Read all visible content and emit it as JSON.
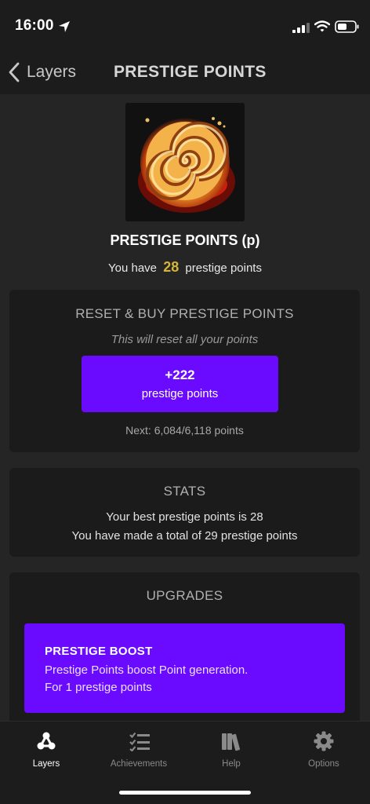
{
  "status_bar": {
    "time": "16:00",
    "icons": [
      "location-arrow-icon",
      "signal-icon",
      "wifi-icon",
      "battery-icon"
    ]
  },
  "nav": {
    "back_label": "Layers",
    "title": "PRESTIGE POINTS"
  },
  "layer": {
    "image_icon": "spiral-cinnamon-roll-image",
    "name": "PRESTIGE POINTS (p)",
    "have_prefix": "You have",
    "have_amount": "28",
    "have_suffix": "prestige points"
  },
  "reset_card": {
    "heading": "RESET & BUY PRESTIGE POINTS",
    "note": "This will reset all your points",
    "button_gain": "+222",
    "button_unit": "prestige points",
    "next": "Next: 6,084/6,118 points"
  },
  "stats_card": {
    "heading": "STATS",
    "best": "Your best prestige points is 28",
    "total": "You have made a total of 29 prestige points"
  },
  "upgrades_card": {
    "heading": "UPGRADES",
    "upgrades": [
      {
        "title": "PRESTIGE BOOST",
        "description": "Prestige Points boost Point generation.",
        "cost": "For 1 prestige points"
      }
    ]
  },
  "tab_bar": {
    "tabs": [
      {
        "label": "Layers",
        "icon": "layers-icon",
        "active": true
      },
      {
        "label": "Achievements",
        "icon": "checklist-icon",
        "active": false
      },
      {
        "label": "Help",
        "icon": "books-icon",
        "active": false
      },
      {
        "label": "Options",
        "icon": "gear-icon",
        "active": false
      }
    ]
  },
  "colors": {
    "background": "#252525",
    "card": "#1b1b1b",
    "accent": "#6a0bff",
    "amount": "#d4b43a"
  }
}
